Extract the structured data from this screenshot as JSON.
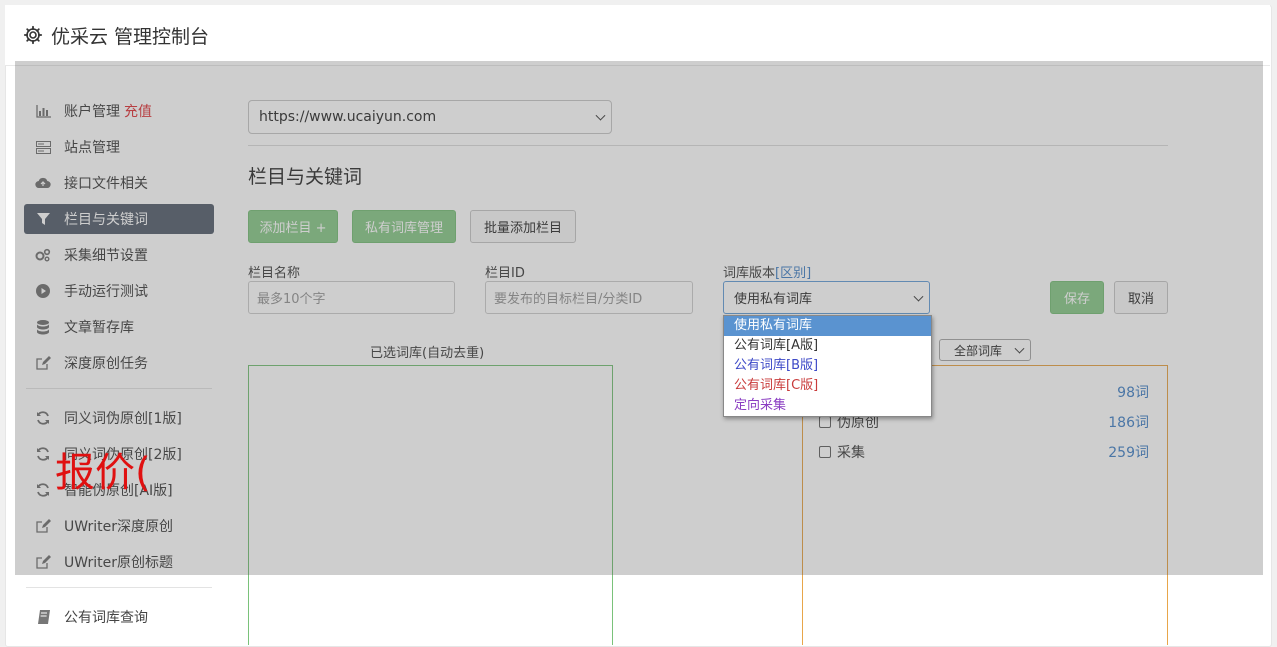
{
  "header": {
    "title": "优采云 管理控制台"
  },
  "sidebar": {
    "items": [
      {
        "label": "账户管理",
        "extra": "充值",
        "icon": "bar-chart-icon"
      },
      {
        "label": "站点管理",
        "icon": "server-icon"
      },
      {
        "label": "接口文件相关",
        "icon": "cloud-upload-icon"
      },
      {
        "label": "栏目与关键词",
        "icon": "filter-icon",
        "active": true
      },
      {
        "label": "采集细节设置",
        "icon": "gears-icon"
      },
      {
        "label": "手动运行测试",
        "icon": "play-circle-icon"
      },
      {
        "label": "文章暂存库",
        "icon": "database-icon"
      },
      {
        "label": "深度原创任务",
        "icon": "edit-icon"
      }
    ],
    "items2": [
      {
        "label": "同义词伪原创[1版]",
        "icon": "refresh-icon"
      },
      {
        "label": "同义词伪原创[2版]",
        "icon": "refresh-icon"
      },
      {
        "label": "智能伪原创[AI版]",
        "icon": "refresh-icon"
      },
      {
        "label": "UWriter深度原创",
        "icon": "edit-icon"
      },
      {
        "label": "UWriter原创标题",
        "icon": "edit-icon"
      }
    ],
    "items3": [
      {
        "label": "公有词库查询",
        "icon": "book-icon"
      }
    ]
  },
  "watermark": "报价(",
  "main": {
    "site_select": "https://www.ucaiyun.com",
    "section_title": "栏目与关键词",
    "buttons": {
      "add_column": "添加栏目 +",
      "private_lib": "私有词库管理",
      "batch_add": "批量添加栏目"
    },
    "form": {
      "name_label": "栏目名称",
      "name_placeholder": "最多10个字",
      "id_label": "栏目ID",
      "id_placeholder": "要发布的目标栏目/分类ID",
      "version_label": "词库版本",
      "version_diff": "[区别]",
      "version_value": "使用私有词库",
      "save": "保存",
      "cancel": "取消"
    },
    "selected_title": "已选词库(自动去重)",
    "all_libs_select": "全部词库",
    "libs": [
      {
        "name": "",
        "count": "98词"
      },
      {
        "name": "伪原创",
        "count": "186词"
      },
      {
        "name": "采集",
        "count": "259词"
      }
    ]
  },
  "dropdown": {
    "options": [
      {
        "label": "使用私有词库",
        "style": "selected"
      },
      {
        "label": "公有词库[A版]",
        "style": "c-default"
      },
      {
        "label": "公有词库[B版]",
        "style": "c-blue"
      },
      {
        "label": "公有词库[C版]",
        "style": "c-red"
      },
      {
        "label": "定向采集",
        "style": "c-purple"
      }
    ]
  }
}
